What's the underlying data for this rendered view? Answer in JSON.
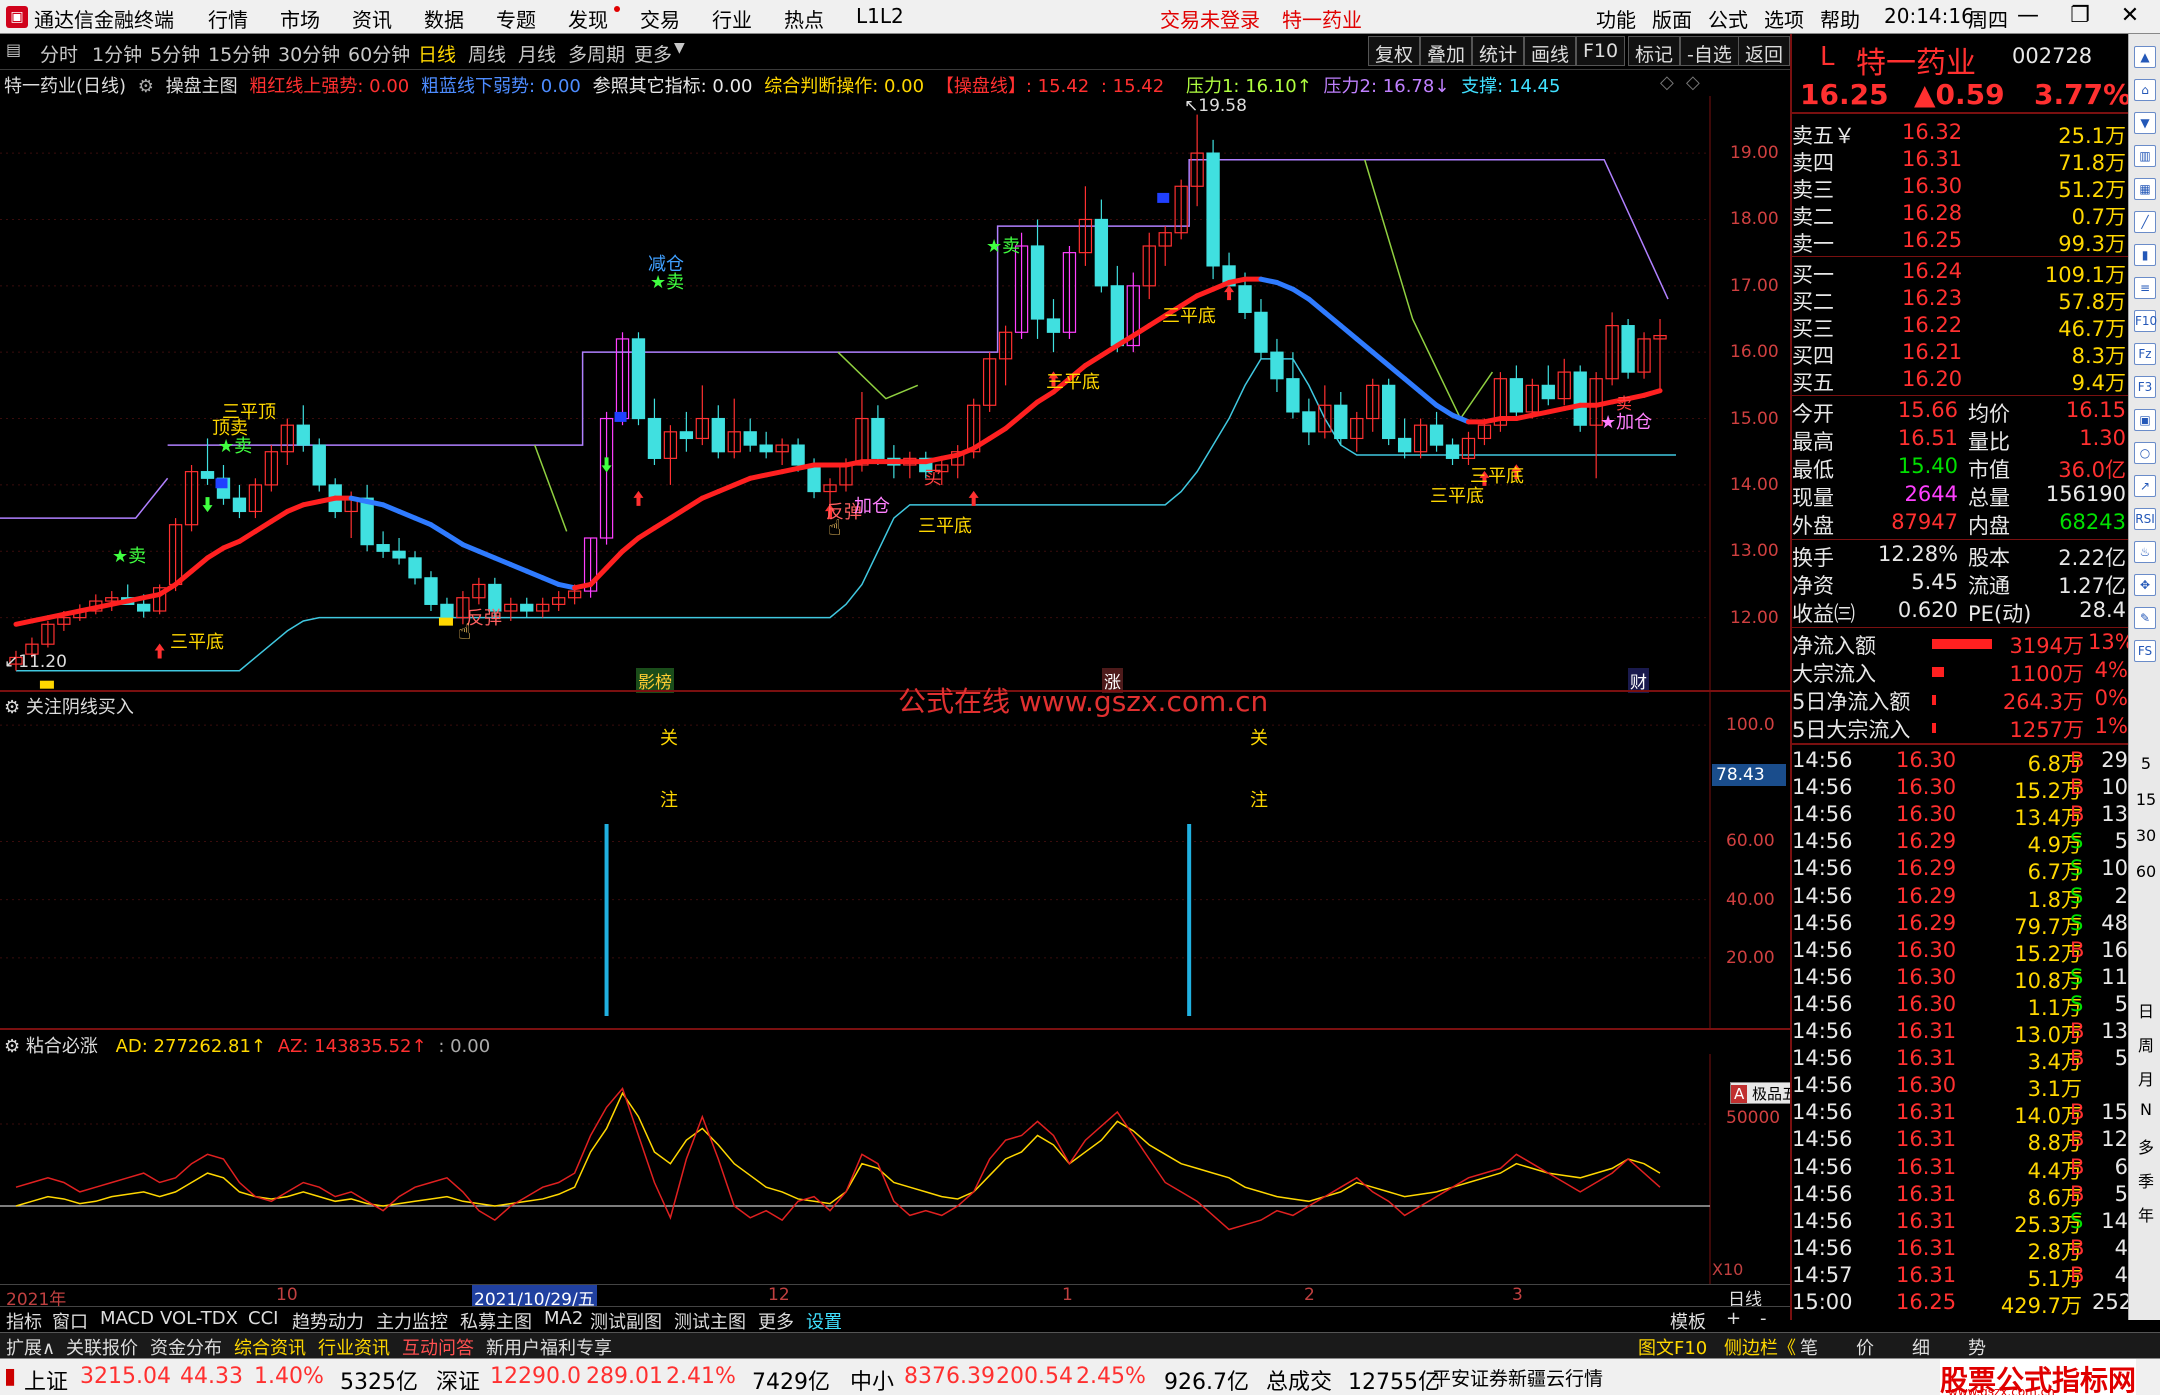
{
  "app": {
    "title": "通达信金融终端",
    "menus": [
      "行情",
      "市场",
      "资讯",
      "数据",
      "专题",
      "发现",
      "交易",
      "行业",
      "热点",
      "L1L2"
    ],
    "login_status": "交易未登录",
    "stock_tag": "特一药业",
    "right_menus": [
      "功能",
      "版面",
      "公式",
      "选项",
      "帮助"
    ],
    "clock": "20:14:16",
    "weekday": "周四"
  },
  "toolbar": {
    "periods": [
      "分时",
      "1分钟",
      "5分钟",
      "15分钟",
      "30分钟",
      "60分钟",
      "日线",
      "周线",
      "月线",
      "多周期",
      "更多"
    ],
    "active_period": "日线",
    "buttons": [
      "复权",
      "叠加",
      "统计",
      "画线",
      "F10",
      "标记",
      "-自选",
      "返回"
    ]
  },
  "main_legend": {
    "stock": "特一药业(日线)",
    "indicator": "操盘主图",
    "red_line": "粗红线上强势: 0.00",
    "blue_line": "粗蓝线下弱势: 0.00",
    "ref": "参照其它指标: 0.00",
    "judge": "综合判断操作: 0.00",
    "op1": "【操盘线】: 15.42",
    "op2": ": 15.42",
    "p1": "压力1: 16.10↑",
    "p2": "压力2: 16.78↓",
    "support": "支撑: 14.45"
  },
  "main_axis": [
    "19.00",
    "18.00",
    "17.00",
    "16.00",
    "15.00",
    "14.00",
    "13.00",
    "12.00"
  ],
  "price_marks": {
    "high": "19.58",
    "low": "11.20"
  },
  "annotations": {
    "sanpingdi": "三平底",
    "sanpingding": "三平顶",
    "dingmai": "顶卖",
    "jiancang": "减仓",
    "mai": "★卖",
    "mai2": "卖",
    "buy": "买",
    "fantan": "反弹",
    "jiacang": "加仓",
    "jiacang2": "★加仓"
  },
  "bottom_tags": [
    "影榜",
    "涨",
    "财"
  ],
  "watermark": "公式在线  www.gszx.com.cn",
  "sub1": {
    "title": "关注阴线买入",
    "axis": [
      "100.0",
      "60.00",
      "40.00",
      "20.00"
    ],
    "value": "78.43",
    "mark1": "关",
    "mark2": "注"
  },
  "sub2": {
    "title": "粘合必涨",
    "ad": "AD: 277262.81↑",
    "az": "AZ: 143835.52↑",
    "z": ": 0.00",
    "axis": "50000",
    "x10": "X10"
  },
  "date_axis": {
    "y2021": "2021年",
    "m10": "10",
    "cursor": "2021/10/29/五",
    "m12": "12",
    "m1": "1",
    "m2": "2",
    "m3": "3",
    "period": "日线"
  },
  "wubi": "极品五笔",
  "tabs": [
    "指标",
    "窗口",
    "MACD",
    "VOL-TDX",
    "CCI",
    "趋势动力",
    "主力监控",
    "私募主图",
    "MA2",
    "测试副图",
    "测试主图",
    "更多",
    "设置"
  ],
  "tabs_right": [
    "模板",
    "+",
    "-"
  ],
  "ext": [
    "扩展∧",
    "关联报价",
    "资金分布",
    "综合资讯",
    "行业资讯",
    "互动问答",
    "新用户福利专享"
  ],
  "ext_right": [
    "图文F10",
    "侧边栏《",
    "笔",
    "价",
    "细",
    "势"
  ],
  "quote": {
    "prefix": "L",
    "name": "特一药业",
    "code": "002728",
    "price": "16.25",
    "change": "▲0.59",
    "pct": "3.77%",
    "asks": [
      [
        "卖五￥",
        "16.32",
        "25.1万"
      ],
      [
        "卖四",
        "16.31",
        "71.8万"
      ],
      [
        "卖三",
        "16.30",
        "51.2万"
      ],
      [
        "卖二",
        "16.28",
        "0.7万"
      ],
      [
        "卖一",
        "16.25",
        "99.3万"
      ]
    ],
    "bids": [
      [
        "买一",
        "16.24",
        "109.1万"
      ],
      [
        "买二",
        "16.23",
        "57.8万"
      ],
      [
        "买三",
        "16.22",
        "46.7万"
      ],
      [
        "买四",
        "16.21",
        "8.3万"
      ],
      [
        "买五",
        "16.20",
        "9.4万"
      ]
    ],
    "stats": [
      [
        "今开",
        "15.66",
        "均价",
        "16.15"
      ],
      [
        "最高",
        "16.51",
        "量比",
        "1.30"
      ],
      [
        "最低",
        "15.40",
        "市值",
        "36.0亿"
      ],
      [
        "现量",
        "2644",
        "总量",
        "156190"
      ],
      [
        "外盘",
        "87947",
        "内盘",
        "68243"
      ]
    ],
    "stats2": [
      [
        "换手",
        "12.28%",
        "股本",
        "2.22亿"
      ],
      [
        "净资",
        "5.45",
        "流通",
        "1.27亿"
      ],
      [
        "收益㈢",
        "0.620",
        "PE(动)",
        "28.4"
      ]
    ],
    "flows": [
      [
        "净流入额",
        "3194万",
        "13%"
      ],
      [
        "大宗流入",
        "1100万",
        "4%"
      ],
      [
        "5日净流入额",
        "264.3万",
        "0%"
      ],
      [
        "5日大宗流入",
        "1257万",
        "1%"
      ]
    ],
    "ticks": [
      [
        "14:56",
        "16.30",
        "6.8万",
        "B",
        "29"
      ],
      [
        "14:56",
        "16.30",
        "15.2万",
        "B",
        "10"
      ],
      [
        "14:56",
        "16.30",
        "13.4万",
        "B",
        "13"
      ],
      [
        "14:56",
        "16.29",
        "4.9万",
        "S",
        "5"
      ],
      [
        "14:56",
        "16.29",
        "6.7万",
        "S",
        "10"
      ],
      [
        "14:56",
        "16.29",
        "1.8万",
        "S",
        "2"
      ],
      [
        "14:56",
        "16.29",
        "79.7万",
        "S",
        "48"
      ],
      [
        "14:56",
        "16.30",
        "15.2万",
        "B",
        "16"
      ],
      [
        "14:56",
        "16.30",
        "10.8万",
        "S",
        "11"
      ],
      [
        "14:56",
        "16.30",
        "1.1万",
        "S",
        "5"
      ],
      [
        "14:56",
        "16.31",
        "13.0万",
        "B",
        "13"
      ],
      [
        "14:56",
        "16.31",
        "3.4万",
        "B",
        "5"
      ],
      [
        "14:56",
        "16.30",
        "3.1万",
        "",
        ""
      ],
      [
        "14:56",
        "16.31",
        "14.0万",
        "B",
        "15"
      ],
      [
        "14:56",
        "16.31",
        "8.8万",
        "B",
        "12"
      ],
      [
        "14:56",
        "16.31",
        "4.4万",
        "B",
        "6"
      ],
      [
        "14:56",
        "16.31",
        "8.6万",
        "B",
        "5"
      ],
      [
        "14:56",
        "16.31",
        "25.3万",
        "S",
        "14"
      ],
      [
        "14:56",
        "16.31",
        "2.8万",
        "B",
        "4"
      ],
      [
        "14:57",
        "16.31",
        "5.1万",
        "B",
        "4"
      ],
      [
        "15:00",
        "16.25",
        "429.7万",
        "",
        "252"
      ]
    ]
  },
  "side_labels": [
    "日",
    "周",
    "月",
    "N",
    "多",
    "季",
    "年"
  ],
  "side_nums": [
    "5",
    "15",
    "30",
    "60"
  ],
  "status": {
    "sh_name": "上证",
    "sh": "3215.04",
    "sh_chg": "44.33",
    "sh_pct": "1.40%",
    "sh_amt": "5325亿",
    "sz_name": "深证",
    "sz": "12290.0",
    "sz_chg": "289.01",
    "sz_pct": "2.41%",
    "sz_amt": "7429亿",
    "zx_name": "中小",
    "zx": "8376.39",
    "zx_chg": "200.54",
    "zx_pct": "2.45%",
    "zx_amt": "926.7亿",
    "total_label": "总成交",
    "total": "12755亿",
    "broker": "平安证券新疆云行情",
    "brand": "股票公式指标网",
    "site": "www.gszx.com.cn"
  },
  "chart_data": {
    "type": "candlestick",
    "title": "特一药业(日线)",
    "ylim": [
      11.0,
      19.8
    ],
    "candles": [
      [
        11.3,
        11.5,
        11.2,
        11.4
      ],
      [
        11.45,
        11.7,
        11.4,
        11.6
      ],
      [
        11.6,
        11.95,
        11.55,
        11.9
      ],
      [
        11.9,
        12.1,
        11.8,
        12.0
      ],
      [
        12.0,
        12.2,
        11.95,
        12.1
      ],
      [
        12.1,
        12.35,
        12.05,
        12.25
      ],
      [
        12.25,
        12.4,
        12.1,
        12.3
      ],
      [
        12.3,
        12.5,
        12.2,
        12.2
      ],
      [
        12.2,
        12.35,
        12.0,
        12.1
      ],
      [
        12.1,
        12.5,
        12.05,
        12.45
      ],
      [
        12.5,
        13.5,
        12.4,
        13.4
      ],
      [
        13.4,
        14.3,
        13.3,
        14.2
      ],
      [
        14.2,
        14.7,
        14.0,
        14.1
      ],
      [
        14.1,
        14.3,
        13.7,
        13.8
      ],
      [
        13.8,
        14.0,
        13.5,
        13.6
      ],
      [
        13.6,
        14.1,
        13.5,
        14.0
      ],
      [
        14.0,
        14.6,
        13.9,
        14.5
      ],
      [
        14.5,
        15.0,
        14.3,
        14.9
      ],
      [
        14.9,
        15.2,
        14.5,
        14.6
      ],
      [
        14.6,
        14.7,
        13.9,
        14.0
      ],
      [
        14.0,
        14.1,
        13.5,
        13.6
      ],
      [
        13.6,
        13.9,
        13.2,
        13.8
      ],
      [
        13.8,
        14.0,
        13.0,
        13.1
      ],
      [
        13.1,
        13.3,
        12.9,
        13.0
      ],
      [
        13.0,
        13.2,
        12.8,
        12.9
      ],
      [
        12.9,
        13.0,
        12.5,
        12.6
      ],
      [
        12.6,
        12.7,
        12.1,
        12.2
      ],
      [
        12.2,
        12.3,
        11.9,
        12.0
      ],
      [
        12.0,
        12.4,
        11.9,
        12.3
      ],
      [
        12.3,
        12.6,
        12.2,
        12.5
      ],
      [
        12.5,
        12.6,
        12.0,
        12.1
      ],
      [
        12.1,
        12.3,
        11.95,
        12.2
      ],
      [
        12.2,
        12.3,
        12.0,
        12.1
      ],
      [
        12.1,
        12.3,
        12.0,
        12.2
      ],
      [
        12.2,
        12.4,
        12.1,
        12.3
      ],
      [
        12.3,
        12.5,
        12.2,
        12.4
      ],
      [
        12.4,
        13.2,
        12.3,
        13.2
      ],
      [
        13.2,
        15.1,
        13.1,
        15.0
      ],
      [
        15.0,
        16.3,
        14.9,
        16.2
      ],
      [
        16.2,
        16.3,
        14.9,
        15.0
      ],
      [
        15.0,
        15.3,
        14.3,
        14.4
      ],
      [
        14.4,
        14.9,
        14.0,
        14.8
      ],
      [
        14.8,
        15.1,
        14.5,
        14.7
      ],
      [
        14.7,
        15.5,
        14.6,
        15.0
      ],
      [
        15.0,
        15.2,
        14.4,
        14.5
      ],
      [
        14.5,
        15.3,
        14.4,
        14.8
      ],
      [
        14.8,
        15.0,
        14.5,
        14.6
      ],
      [
        14.6,
        14.8,
        14.4,
        14.5
      ],
      [
        14.5,
        14.7,
        14.3,
        14.6
      ],
      [
        14.6,
        14.7,
        14.2,
        14.3
      ],
      [
        14.3,
        14.4,
        13.8,
        13.9
      ],
      [
        13.9,
        14.1,
        13.6,
        14.0
      ],
      [
        14.0,
        14.4,
        13.9,
        14.3
      ],
      [
        14.3,
        15.4,
        14.2,
        15.0
      ],
      [
        15.0,
        15.2,
        14.3,
        14.4
      ],
      [
        14.4,
        14.6,
        14.1,
        14.3
      ],
      [
        14.3,
        14.5,
        14.1,
        14.4
      ],
      [
        14.4,
        14.5,
        14.1,
        14.2
      ],
      [
        14.2,
        14.4,
        14.0,
        14.3
      ],
      [
        14.3,
        14.6,
        14.1,
        14.5
      ],
      [
        14.5,
        15.3,
        14.4,
        15.2
      ],
      [
        15.2,
        16.0,
        15.1,
        15.9
      ],
      [
        15.9,
        16.4,
        15.5,
        16.3
      ],
      [
        16.3,
        17.8,
        16.2,
        17.6
      ],
      [
        17.6,
        18.0,
        16.2,
        16.5
      ],
      [
        16.5,
        16.8,
        16.0,
        16.3
      ],
      [
        16.3,
        17.6,
        16.2,
        17.5
      ],
      [
        17.5,
        18.5,
        17.3,
        18.0
      ],
      [
        18.0,
        18.3,
        16.9,
        17.0
      ],
      [
        17.0,
        17.3,
        16.0,
        16.1
      ],
      [
        16.1,
        17.2,
        16.0,
        17.0
      ],
      [
        17.0,
        17.8,
        16.8,
        17.6
      ],
      [
        17.6,
        17.9,
        17.3,
        17.8
      ],
      [
        17.8,
        18.6,
        17.7,
        18.5
      ],
      [
        18.5,
        19.58,
        18.2,
        19.0
      ],
      [
        19.0,
        19.2,
        17.1,
        17.3
      ],
      [
        17.3,
        17.5,
        16.8,
        17.0
      ],
      [
        17.0,
        17.2,
        16.5,
        16.6
      ],
      [
        16.6,
        16.8,
        15.9,
        16.0
      ],
      [
        16.0,
        16.2,
        15.4,
        15.6
      ],
      [
        15.6,
        16.0,
        15.0,
        15.1
      ],
      [
        15.1,
        15.3,
        14.6,
        14.8
      ],
      [
        14.8,
        15.5,
        14.7,
        15.2
      ],
      [
        15.2,
        15.4,
        14.6,
        14.7
      ],
      [
        14.7,
        15.1,
        14.5,
        15.0
      ],
      [
        15.0,
        15.6,
        14.8,
        15.5
      ],
      [
        15.5,
        15.6,
        14.6,
        14.7
      ],
      [
        14.7,
        15.0,
        14.4,
        14.5
      ],
      [
        14.5,
        15.0,
        14.4,
        14.9
      ],
      [
        14.9,
        15.1,
        14.5,
        14.6
      ],
      [
        14.6,
        14.7,
        14.3,
        14.4
      ],
      [
        14.4,
        14.8,
        14.3,
        14.7
      ],
      [
        14.7,
        15.0,
        14.6,
        14.9
      ],
      [
        14.9,
        15.7,
        14.8,
        15.6
      ],
      [
        15.6,
        15.8,
        15.0,
        15.1
      ],
      [
        15.1,
        15.6,
        15.0,
        15.5
      ],
      [
        15.5,
        15.8,
        15.2,
        15.3
      ],
      [
        15.3,
        15.9,
        15.2,
        15.7
      ],
      [
        15.7,
        15.8,
        14.8,
        14.9
      ],
      [
        14.9,
        15.7,
        14.1,
        15.6
      ],
      [
        15.6,
        16.6,
        15.5,
        16.4
      ],
      [
        16.4,
        16.5,
        15.6,
        15.7
      ],
      [
        15.7,
        16.3,
        15.6,
        16.2
      ],
      [
        16.2,
        16.5,
        15.4,
        16.25
      ]
    ],
    "ma_red": [
      11.9,
      11.95,
      12.0,
      12.05,
      12.1,
      12.15,
      12.2,
      12.25,
      12.3,
      12.35,
      12.5,
      12.7,
      12.9,
      13.05,
      13.15,
      13.3,
      13.45,
      13.6,
      13.7,
      13.75,
      13.8,
      13.8,
      13.75,
      13.7,
      13.6,
      13.5,
      13.4,
      13.25,
      13.1,
      13.0,
      12.9,
      12.8,
      12.7,
      12.6,
      12.5,
      12.45,
      12.5,
      12.75,
      13.0,
      13.2,
      13.35,
      13.5,
      13.65,
      13.8,
      13.9,
      14.0,
      14.1,
      14.15,
      14.2,
      14.25,
      14.3,
      14.3,
      14.3,
      14.35,
      14.35,
      14.35,
      14.35,
      14.35,
      14.4,
      14.45,
      14.55,
      14.7,
      14.85,
      15.05,
      15.25,
      15.4,
      15.6,
      15.8,
      15.95,
      16.1,
      16.25,
      16.4,
      16.55,
      16.7,
      16.85,
      16.95,
      17.05,
      17.1,
      17.1,
      17.05,
      16.95,
      16.8,
      16.6,
      16.4,
      16.2,
      16.0,
      15.8,
      15.6,
      15.4,
      15.2,
      15.05,
      14.95,
      14.95,
      15.0,
      15.0,
      15.05,
      15.1,
      15.15,
      15.2,
      15.2,
      15.25,
      15.3,
      15.35,
      15.42
    ],
    "support": [
      11.2,
      11.2,
      11.2,
      11.2,
      11.2,
      11.2,
      11.2,
      11.2,
      11.2,
      11.2,
      11.2,
      11.2,
      11.2,
      11.2,
      11.2,
      11.4,
      11.6,
      11.8,
      11.95,
      12.0,
      12.0,
      12.0,
      12.0,
      12.0,
      12.0,
      12.0,
      12.0,
      12.0,
      12.0,
      12.0,
      12.0,
      12.0,
      12.0,
      12.0,
      12.0,
      12.0,
      12.0,
      12.0,
      12.0,
      12.0,
      12.0,
      12.0,
      12.0,
      12.0,
      12.0,
      12.0,
      12.0,
      12.0,
      12.0,
      12.0,
      12.0,
      12.0,
      12.2,
      12.5,
      13.0,
      13.5,
      13.7,
      13.7,
      13.7,
      13.7,
      13.7,
      13.7,
      13.7,
      13.7,
      13.7,
      13.7,
      13.7,
      13.7,
      13.7,
      13.7,
      13.7,
      13.7,
      13.7,
      13.9,
      14.2,
      14.6,
      15.0,
      15.5,
      15.9,
      15.9,
      15.9,
      15.5,
      15.0,
      14.6,
      14.45,
      14.45,
      14.45,
      14.45,
      14.45,
      14.45,
      14.45,
      14.45,
      14.45,
      14.45,
      14.45,
      14.45,
      14.45,
      14.45,
      14.45,
      14.45,
      14.45,
      14.45,
      14.45,
      14.45,
      14.45
    ],
    "vol_bars": [
      {
        "x": 32,
        "v": 66
      },
      {
        "x": 81,
        "v": 66
      }
    ],
    "ad": [
      12,
      14,
      16,
      15,
      13,
      14,
      16,
      17,
      18,
      16,
      18,
      22,
      26,
      24,
      18,
      16,
      15,
      16,
      18,
      16,
      14,
      15,
      13,
      12,
      13,
      14,
      15,
      16,
      14,
      13,
      12,
      13,
      14,
      15,
      17,
      20,
      35,
      45,
      60,
      50,
      35,
      30,
      40,
      45,
      38,
      30,
      25,
      20,
      18,
      15,
      14,
      13,
      18,
      30,
      28,
      22,
      20,
      18,
      16,
      15,
      18,
      25,
      32,
      35,
      42,
      38,
      30,
      35,
      40,
      48,
      44,
      38,
      34,
      30,
      28,
      26,
      24,
      20,
      18,
      16,
      15,
      14,
      16,
      18,
      22,
      20,
      18,
      16,
      17,
      18,
      20,
      22,
      24,
      26,
      30,
      28,
      26,
      25,
      24,
      26,
      28,
      32,
      30,
      26
    ],
    "az": [
      8,
      10,
      12,
      10,
      6,
      8,
      10,
      12,
      14,
      10,
      12,
      18,
      22,
      20,
      10,
      4,
      2,
      6,
      10,
      8,
      4,
      6,
      2,
      -2,
      4,
      8,
      10,
      12,
      6,
      -2,
      -6,
      0,
      4,
      8,
      10,
      14,
      30,
      42,
      50,
      30,
      10,
      -5,
      20,
      38,
      20,
      0,
      -5,
      -2,
      -6,
      2,
      4,
      -2,
      6,
      22,
      18,
      2,
      -4,
      -2,
      -4,
      0,
      6,
      20,
      28,
      30,
      36,
      30,
      18,
      28,
      34,
      40,
      30,
      20,
      10,
      6,
      2,
      -4,
      -10,
      -8,
      -6,
      -2,
      -4,
      0,
      4,
      8,
      12,
      6,
      2,
      -4,
      0,
      4,
      8,
      12,
      14,
      16,
      22,
      18,
      14,
      10,
      6,
      10,
      14,
      20,
      14,
      8
    ]
  }
}
